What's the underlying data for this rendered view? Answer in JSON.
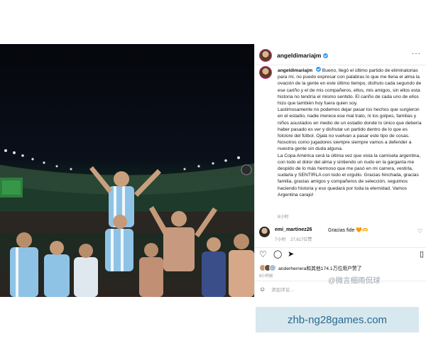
{
  "post": {
    "username": "angeldimariajm",
    "caption_user": "angeldimariajm",
    "caption_text": "Bueno, llegó el último partido de eliminatorias para mí, no puedo expresar con palabras lo que me llena el alma la ovación de la gente en este último tiempo, disfruto cada segundo de ese cariño y el de mis compañeros, ellos, mis amigos, sin ellos esta historia no tendría el mismo sentido. El cariño de cada uno de ellos hizo que también hoy fuera quien soy.",
    "caption_text_2": "Lastimosamente no podemos dejar pasar los hechos que surgieron en el estadio, nadie merece ese mal trato, ni los golpes, familias y niños asustados en medio de un estadio donde lo único que debería haber pasado es ver y disfrutar un partido dentro de lo que es folclore del fútbol. Ojalá no vuelvan a pasar este tipo de cosas. Nosotros como jugadores siempre siempre vamos a defender a nuestra gente sin duda alguna.",
    "caption_text_3": "La Copa América será la última vez que vista la camiseta argentina, con todo el dolor del alma y sintiendo un nudo en la garganta me despido de lo más hermoso que me pasó en mi carrera, vestirla, sudarla y SENTIRLA con todo el orgullo. Gracias hinchada, gracias familia, gracias amigos y compañeros de selección, seguimos haciendo historia y eso quedará por toda la eternidad. Vamos Argentina carajo!",
    "caption_time": "8小时",
    "comment": {
      "user": "emi_martinez26",
      "text": "Gracias fide 🧡🫶",
      "time": "7小时",
      "likes": "27,617位赞"
    },
    "likes_text": "anderherrera和其他174.1万位用户赞了",
    "post_time": "8小时前",
    "add_comment_placeholder": "添加评论…",
    "watermark": "@微言细雨侃球"
  },
  "banner": {
    "text": "zhb-ng28games.com"
  },
  "icons": {
    "like": "heart-icon",
    "comment": "comment-icon",
    "share": "share-icon",
    "save": "bookmark-icon",
    "more": "more-options-icon",
    "emoji": "emoji-icon"
  },
  "colors": {
    "verified": "#3897f0",
    "banner_bg": "#d7e8ef",
    "banner_text": "#2a6a92"
  }
}
